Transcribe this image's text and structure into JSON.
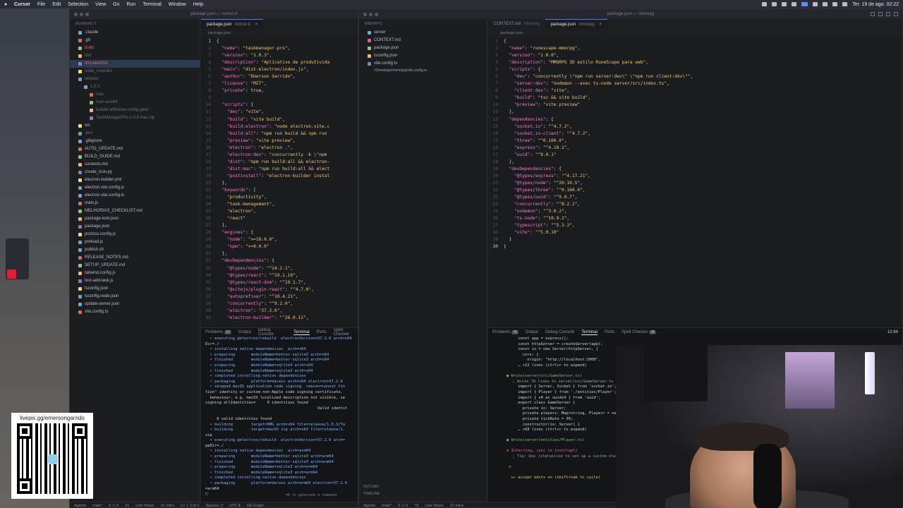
{
  "menubar": {
    "app": "Cursor",
    "items": [
      "File",
      "Edit",
      "Selection",
      "View",
      "Go",
      "Run",
      "Terminal",
      "Window",
      "Help"
    ],
    "clock": "Ter. 19 de ago.  02:22"
  },
  "stream": {
    "url": "livepix.gg/emersongarrido"
  },
  "left_window": {
    "title": "package.json — runrun.it",
    "explorer_header": "RUNRUN.IT",
    "files": [
      ".claude",
      ".git",
      "build",
      "dist",
      "dist-electron",
      "node_modules",
      "release",
      "1.0.3",
      "mac",
      "mac-arm64",
      "builder-effective-config.yaml",
      "TaskManagerPro-1.0.3-mac.zip",
      "src",
      ".env",
      ".gitignore",
      "AUTO_UPDATE.md",
      "BUILD_GUIDE.md",
      "contexto.md",
      "create_icon.py",
      "electron-builder.yml",
      "electron.vite.config.js",
      "electron.vite.config.ts",
      "main.js",
      "MELHORIAS_CHECKLIST.md",
      "package-lock.json",
      "package.json",
      "postcss.config.js",
      "preload.js",
      "publish.sh",
      "RELEASE_NOTES.md",
      "SETUP_UPDATE.md",
      "tailwind.config.js",
      "test-add-task.js",
      "tsconfig.json",
      "tsconfig.node.json",
      "update-server.json",
      "vite.config.ts"
    ],
    "tab_label": "package.json",
    "tab_sub": "runrun.it",
    "breadcrumb": "package.json",
    "code": [
      {
        "n": "1",
        "t": "{"
      },
      {
        "n": "2",
        "t": "  \"name\": \"taskmanager-pro\","
      },
      {
        "n": "3",
        "t": "  \"version\": \"1.0.3\","
      },
      {
        "n": "4",
        "t": "  \"description\": \"Aplicativo de produtivida"
      },
      {
        "n": "5",
        "t": "  \"main\": \"dist-electron/index.js\","
      },
      {
        "n": "6",
        "t": "  \"author\": \"Emerson Garrido\","
      },
      {
        "n": "7",
        "t": "  \"license\": \"MIT\","
      },
      {
        "n": "8",
        "t": "  \"private\": true,"
      },
      {
        "n": "9",
        "t": ""
      },
      {
        "n": "10",
        "t": "  \"scripts\": {"
      },
      {
        "n": "11",
        "t": "    \"dev\": \"vite\","
      },
      {
        "n": "12",
        "t": "    \"build\": \"vite build\","
      },
      {
        "n": "13",
        "t": "    \"build:electron\": \"node electron.vite.c"
      },
      {
        "n": "14",
        "t": "    \"build:all\": \"npm run build && npm run"
      },
      {
        "n": "15",
        "t": "    \"preview\": \"vite preview\","
      },
      {
        "n": "16",
        "t": "    \"electron\": \"electron .\","
      },
      {
        "n": "17",
        "t": "    \"electron:dev\": \"concurrently -k \\\"npm"
      },
      {
        "n": "18",
        "t": "    \"dist\": \"npm run build:all && electron-"
      },
      {
        "n": "19",
        "t": "    \"dist:mac\": \"npm run build:all && elect"
      },
      {
        "n": "20",
        "t": "    \"postinstall\": \"electron-builder instal"
      },
      {
        "n": "21",
        "t": "  },"
      },
      {
        "n": "22",
        "t": "  \"keywords\": ["
      },
      {
        "n": "23",
        "t": "    \"productivity\","
      },
      {
        "n": "24",
        "t": "    \"task-management\","
      },
      {
        "n": "25",
        "t": "    \"electron\","
      },
      {
        "n": "26",
        "t": "    \"react\""
      },
      {
        "n": "27",
        "t": "  ],"
      },
      {
        "n": "28",
        "t": "  \"engines\": {"
      },
      {
        "n": "29",
        "t": "    \"node\": \">=18.0.0\","
      },
      {
        "n": "30",
        "t": "    \"npm\": \">=9.0.0\""
      },
      {
        "n": "31",
        "t": "  },"
      },
      {
        "n": "32",
        "t": "  \"devDependencies\": {"
      },
      {
        "n": "33",
        "t": "    \"@types/node\": \"^24.2.1\","
      },
      {
        "n": "34",
        "t": "    \"@types/react\": \"^19.1.10\","
      },
      {
        "n": "35",
        "t": "    \"@types/react-dom\": \"^19.1.7\","
      },
      {
        "n": "36",
        "t": "    \"@vitejs/plugin-react\": \"^4.7.0\","
      },
      {
        "n": "37",
        "t": "    \"autoprefixer\": \"^10.4.21\","
      },
      {
        "n": "38",
        "t": "    \"concurrently\": \"^9.2.0\","
      },
      {
        "n": "39",
        "t": "    \"electron\": \"37.2.6\","
      },
      {
        "n": "40",
        "t": "    \"electron-builder\": \"^26.0.12\","
      }
    ],
    "panel_tabs": [
      "Problems",
      "Output",
      "Debug Console",
      "Terminal",
      "Ports",
      "Spell Checker"
    ],
    "problems_badge": "17",
    "terminal": [
      "  • executing @electron/rebuild  electronVersion=37.2.6 arch=x64",
      "Dir=./",
      "  • installing native dependencies  arch=x64",
      "  • preparing       moduleName=better-sqlite3 arch=x64",
      "  • finished        moduleName=better-sqlite3 arch=x64",
      "  • preparing       moduleName=sqlite3 arch=x64",
      "  • finished        moduleName=sqlite3 arch=x64",
      "  • completed installing native dependencies",
      "  • packaging       platform=darwin arch=x64 electron=37.2.6",
      "  • skipped macOS application code signing  reason=cannot fin",
      "tion\" identity or custom non-Apple code signing certificate,",
      "  behaviour, e.g. macOS localized description not visible, se",
      "signing allIdentities=     0 identities found",
      "                                                 Valid identit",
      "",
      "     0 valid identities found",
      "  • building        target=DMG arch=x64 file=release/1.0.3/Ta",
      "  • building        target=macOS zip arch=x64 file=release/1.",
      "zip",
      "  • executing @electron/rebuild  electronVersion=37.2.6 arch=",
      "ppDir=./",
      "  • installing native dependencies  arch=arm64",
      "  • preparing       moduleName=better-sqlite3 arch=arm64",
      "  • finished        moduleName=better-sqlite3 arch=arm64",
      "  • preparing       moduleName=sqlite3 arch=arm64",
      "  • finished        moduleName=sqlite3 arch=arm64",
      "  • completed installing native dependencies",
      "  • packaging       platform=darwin arch=arm64 electron=37.2.6",
      "=arm64",
      "□"
    ],
    "status": [
      "Agents",
      "main*",
      "0 ⚠ 0",
      "31",
      "Live Share",
      "21 mins",
      "Ln 1, Col 1",
      "Spaces: 2",
      "UTF-8",
      "Git Graph"
    ],
    "hint": "⌘K to generate a command"
  },
  "right_window": {
    "title": "package.json — mmorpg",
    "explorer_header": "MMORPG",
    "files": [
      "server",
      "CONTEXT.md",
      "package.json",
      "tsconfig.json",
      "vite.config.ts"
    ],
    "tooltip": "~/Developer/mmorpg/vite.config.ts",
    "tabs": [
      {
        "label": "CONTEXT.md",
        "sub": "mmorpg"
      },
      {
        "label": "package.json",
        "sub": "mmorpg"
      }
    ],
    "breadcrumb": "package.json",
    "code": [
      {
        "n": "1",
        "t": "{"
      },
      {
        "n": "2",
        "t": "  \"name\": \"runescape-mmorpg\","
      },
      {
        "n": "3",
        "t": "  \"version\": \"1.0.0\","
      },
      {
        "n": "4",
        "t": "  \"description\": \"MMORPG 3D estilo RuneScape para web\","
      },
      {
        "n": "5",
        "t": "  \"scripts\": {"
      },
      {
        "n": "6",
        "t": "    \"dev\": \"concurrently \\\"npm run server:dev\\\" \\\"npm run client:dev\\\"\","
      },
      {
        "n": "7",
        "t": "    \"server:dev\": \"nodemon --exec ts-node server/src/index.ts\","
      },
      {
        "n": "8",
        "t": "    \"client:dev\": \"vite\","
      },
      {
        "n": "9",
        "t": "    \"build\": \"tsc && vite build\","
      },
      {
        "n": "10",
        "t": "    \"preview\": \"vite preview\""
      },
      {
        "n": "11",
        "t": "  },"
      },
      {
        "n": "12",
        "t": "  \"dependencies\": {"
      },
      {
        "n": "13",
        "t": "    \"socket.io\": \"^4.7.2\","
      },
      {
        "n": "14",
        "t": "    \"socket.io-client\": \"^4.7.2\","
      },
      {
        "n": "15",
        "t": "    \"three\": \"^0.160.0\","
      },
      {
        "n": "16",
        "t": "    \"express\": \"^4.18.2\","
      },
      {
        "n": "17",
        "t": "    \"uuid\": \"^9.0.1\""
      },
      {
        "n": "18",
        "t": "  },"
      },
      {
        "n": "19",
        "t": "  \"devDependencies\": {"
      },
      {
        "n": "20",
        "t": "    \"@types/express\": \"^4.17.21\","
      },
      {
        "n": "21",
        "t": "    \"@types/node\": \"^20.10.5\","
      },
      {
        "n": "22",
        "t": "    \"@types/three\": \"^0.160.0\","
      },
      {
        "n": "23",
        "t": "    \"@types/uuid\": \"^9.0.7\","
      },
      {
        "n": "24",
        "t": "    \"concurrently\": \"^8.2.2\","
      },
      {
        "n": "25",
        "t": "    \"nodemon\": \"^3.0.2\","
      },
      {
        "n": "26",
        "t": "    \"ts-node\": \"^10.9.2\","
      },
      {
        "n": "27",
        "t": "    \"typescript\": \"^5.3.3\","
      },
      {
        "n": "28",
        "t": "    \"vite\": \"^5.0.10\""
      },
      {
        "n": "29",
        "t": "  }"
      },
      {
        "n": "30",
        "t": "}"
      }
    ],
    "panel_tabs": [
      "Problems",
      "Output",
      "Debug Console",
      "Terminal",
      "Ports",
      "Spell Checker"
    ],
    "problems_badge": "75",
    "spell_badge": "76",
    "terminal": [
      "     const app = express();",
      "     const httpServer = createServer(app);",
      "     const io = new Server(httpServer, {",
      "       cors: {",
      "         origin: \"http://localhost:3000\",",
      "     … +12 lines (ctrl+r to expand)",
      "",
      "● Write(server/src/GameServer.ts)",
      "  ⎿ Wrote 78 lines to server/src/GameServer.ts",
      "     import { Server, Socket } from 'socket.io';",
      "     import { Player } from './entities/Player';",
      "     import { v4 as uuidv4 } from 'uuid';",
      "     export class GameServer {",
      "       private io: Server;",
      "       private players: Map<string, Player> = new",
      "       private tickRate = 30;",
      "       constructor(io: Server) {",
      "     … +68 lines (ctrl+r to expand)",
      "",
      "● Write(server/entities/Player.ts)",
      "",
      "✻ Inferring… (esc to interrupt)",
      "  ⎿ Tip: Use /statusline to set up a custom stat",
      "",
      " >",
      "",
      "  ▸▸ accept edits on (shift+tab to cycle)"
    ],
    "outline": "OUTLINE",
    "timeline": "TIMELINE",
    "status": [
      "Agents",
      "main*",
      "0 ⚠ 0",
      "75",
      "Live Share",
      "21 mins"
    ],
    "zoom": "10.84"
  }
}
